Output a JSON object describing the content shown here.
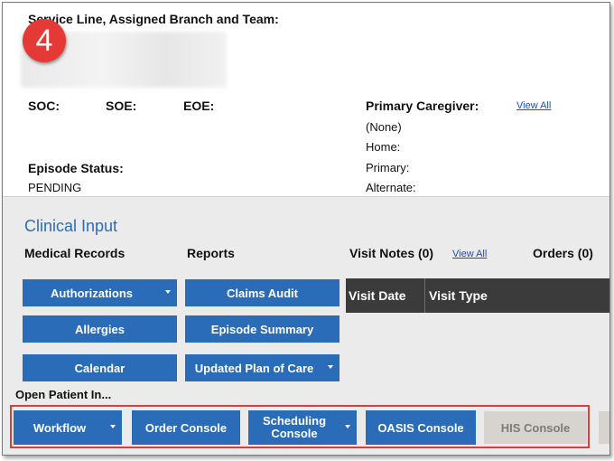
{
  "header": {
    "service_line_label": "Service Line, Assigned Branch and Team:",
    "step_number": "4"
  },
  "episode": {
    "soc_label": "SOC:",
    "soe_label": "SOE:",
    "eoe_label": "EOE:",
    "status_label": "Episode Status:",
    "status_value": "PENDING"
  },
  "caregiver": {
    "label": "Primary Caregiver:",
    "view_all": "View All",
    "name": "(None)",
    "home": "Home:",
    "primary": "Primary:",
    "alternate": "Alternate:"
  },
  "clinical": {
    "title": "Clinical Input",
    "medical_records": "Medical Records",
    "reports": "Reports",
    "visit_notes": "Visit Notes (0)",
    "visit_notes_view_all": "View All",
    "orders": "Orders (0)"
  },
  "medical_buttons": {
    "authorizations": "Authorizations",
    "allergies": "Allergies",
    "calendar": "Calendar"
  },
  "report_buttons": {
    "claims_audit": "Claims Audit",
    "episode_summary": "Episode Summary",
    "updated_plan": "Updated Plan of Care"
  },
  "visit_grid": {
    "columns": [
      "Visit Date",
      "Visit Type"
    ]
  },
  "open_patient": {
    "label": "Open Patient In...",
    "workflow": "Workflow",
    "order_console": "Order Console",
    "scheduling_console": "Scheduling Console",
    "oasis_console": "OASIS Console",
    "his_console": "HIS Console"
  },
  "colors": {
    "primary_button": "#2b6cb8",
    "highlight_box": "#e53935",
    "disabled_button": "#d7d3cf",
    "section_title": "#2e6db4"
  }
}
